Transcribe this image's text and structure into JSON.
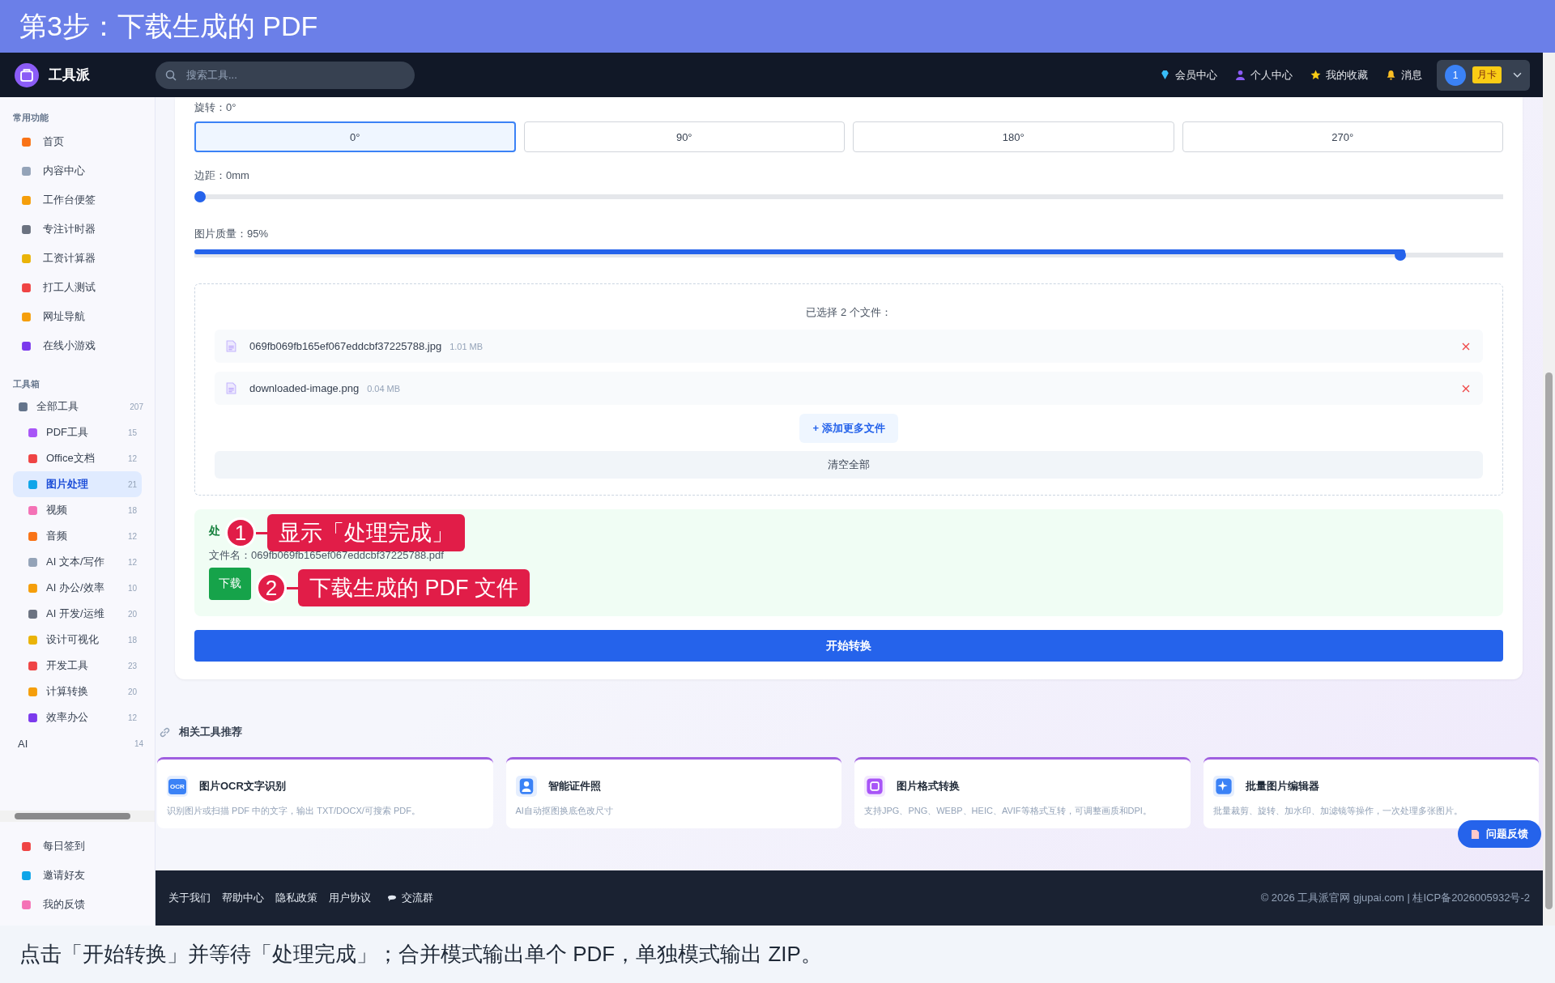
{
  "banner": {
    "title": "第3步：下载生成的 PDF"
  },
  "header": {
    "brand": "工具派",
    "search": {
      "placeholder": "搜索工具..."
    },
    "nav": [
      {
        "label": "会员中心",
        "kind": "gem"
      },
      {
        "label": "个人中心",
        "kind": "person"
      },
      {
        "label": "我的收藏",
        "kind": "star"
      },
      {
        "label": "消息",
        "kind": "bell"
      }
    ],
    "user": {
      "avatar": "1",
      "tag": "月卡"
    }
  },
  "sidebar": {
    "common_title": "常用功能",
    "common": [
      {
        "label": "首页",
        "selected": false
      },
      {
        "label": "内容中心",
        "selected": false
      },
      {
        "label": "工作台便签",
        "selected": false
      },
      {
        "label": "专注计时器",
        "selected": false
      },
      {
        "label": "工资计算器",
        "selected": false
      },
      {
        "label": "打工人测试",
        "selected": false
      },
      {
        "label": "网址导航",
        "selected": false
      },
      {
        "label": "在线小游戏",
        "selected": false
      }
    ],
    "tools_title": "工具箱",
    "tools": [
      {
        "label": "全部工具",
        "count": "207",
        "selected": false,
        "children": [
          {
            "label": "PDF工具",
            "count": "15",
            "selected": false
          },
          {
            "label": "Office文档",
            "count": "12",
            "selected": false
          },
          {
            "label": "图片处理",
            "count": "21",
            "selected": true
          },
          {
            "label": "视频",
            "count": "18",
            "selected": false
          },
          {
            "label": "音频",
            "count": "12",
            "selected": false
          },
          {
            "label": "AI 文本/写作",
            "count": "12",
            "selected": false
          },
          {
            "label": "AI 办公/效率",
            "count": "10",
            "selected": false
          },
          {
            "label": "AI 开发/运维",
            "count": "20",
            "selected": false
          },
          {
            "label": "设计可视化",
            "count": "18",
            "selected": false
          },
          {
            "label": "开发工具",
            "count": "23",
            "selected": false
          },
          {
            "label": "计算转换",
            "count": "20",
            "selected": false
          },
          {
            "label": "效率办公",
            "count": "12",
            "selected": false
          }
        ]
      },
      {
        "label": "AI",
        "count": "14",
        "selected": false
      }
    ],
    "bottom": [
      {
        "label": "每日签到"
      },
      {
        "label": "邀请好友"
      },
      {
        "label": "我的反馈"
      }
    ]
  },
  "settings": {
    "rotation": {
      "label": "旋转：0°",
      "options": [
        {
          "label": "0°",
          "selected": true
        },
        {
          "label": "90°",
          "selected": false
        },
        {
          "label": "180°",
          "selected": false
        },
        {
          "label": "270°",
          "selected": false
        }
      ]
    },
    "margin": {
      "label": "边距：0mm",
      "level": 0
    },
    "quality": {
      "label": "图片质量：95%",
      "level": 0.925
    }
  },
  "files": {
    "title": "已选择 2 个文件：",
    "items": [
      {
        "name": "069fb069fb165ef067eddcbf37225788.jpg",
        "size": "1.01 MB"
      },
      {
        "name": "downloaded-image.png",
        "size": "0.04 MB"
      }
    ],
    "add": "+ 添加更多文件",
    "clear": "清空全部"
  },
  "result": {
    "title": "处",
    "filename": "文件名：069fb069fb165ef067eddcbf37225788.pdf",
    "download": "下载"
  },
  "callouts": [
    {
      "number": "1",
      "text": "显示「处理完成」"
    },
    {
      "number": "2",
      "text": "下载生成的 PDF 文件"
    }
  ],
  "start": "开始转换",
  "related": {
    "title": "相关工具推荐",
    "cards": [
      {
        "kind": "ocr",
        "icon_label": "OCR",
        "title": "图片OCR文字识别",
        "desc": "识别图片或扫描 PDF 中的文字，输出 TXT/DOCX/可搜索 PDF。"
      },
      {
        "kind": "person",
        "title": "智能证件照",
        "desc": "AI自动抠图换底色改尺寸"
      },
      {
        "kind": "convert",
        "title": "图片格式转换",
        "desc": "支持JPG、PNG、WEBP、HEIC、AVIF等格式互转，可调整画质和DPI。"
      },
      {
        "kind": "sparkle",
        "title": "批量图片编辑器",
        "desc": "批量裁剪、旋转、加水印、加滤镜等操作，一次处理多张图片。"
      }
    ]
  },
  "feedback": "问题反馈",
  "footer": {
    "links": [
      {
        "label": "关于我们",
        "kind": "text"
      },
      {
        "label": "帮助中心",
        "kind": "text"
      },
      {
        "label": "隐私政策",
        "kind": "text"
      },
      {
        "label": "用户协议",
        "kind": "text"
      },
      {
        "label": "交流群",
        "kind": "chat"
      }
    ],
    "copyright": "© 2026 工具派官网 gjupai.com | 桂ICP备2026005932号-2"
  },
  "caption": "点击「开始转换」并等待「处理完成」；合并模式输出单个 PDF，单独模式输出 ZIP。"
}
